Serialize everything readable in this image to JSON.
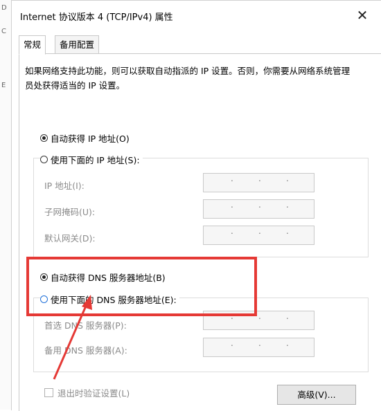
{
  "dialog": {
    "title": "Internet 协议版本 4 (TCP/IPv4) 属性",
    "close_glyph": "✕"
  },
  "tabs": [
    {
      "label": "常规",
      "active": true
    },
    {
      "label": "备用配置",
      "active": false
    }
  ],
  "description": "如果网络支持此功能，则可以获取自动指派的 IP 设置。否则，你需要从网络系统管理员处获得适当的 IP 设置。",
  "ip_section": {
    "auto_label": "自动获得 IP 地址(O)",
    "manual_label": "使用下面的 IP 地址(S):",
    "auto_selected": true,
    "fields": [
      {
        "label": "IP 地址(I):"
      },
      {
        "label": "子网掩码(U):"
      },
      {
        "label": "默认网关(D):"
      }
    ]
  },
  "dns_section": {
    "auto_label": "自动获得 DNS 服务器地址(B)",
    "manual_label": "使用下面的 DNS 服务器地址(E):",
    "auto_selected": true,
    "fields": [
      {
        "label": "首选 DNS 服务器(P):"
      },
      {
        "label": "备用 DNS 服务器(A):"
      }
    ]
  },
  "validate_checkbox": {
    "label": "退出时验证设置(L)",
    "checked": false
  },
  "advanced_button": "高级(V)...",
  "colors": {
    "annotation_red": "#e53935",
    "focus_blue": "#1e6fd9"
  }
}
